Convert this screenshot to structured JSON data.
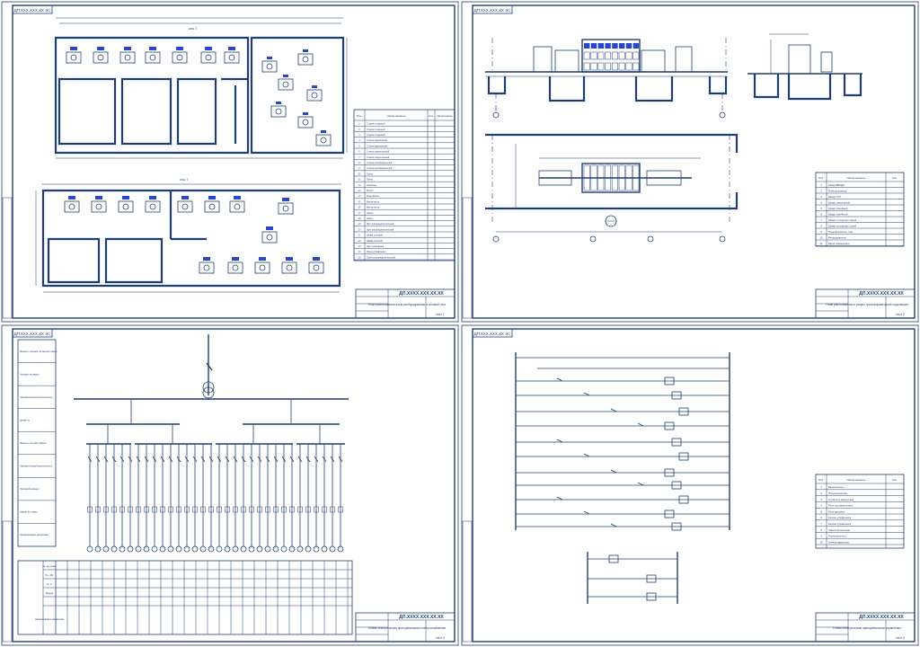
{
  "sheets": {
    "s1": {
      "stamp": "ДП.ХХХ.ХХХ.ХХ ЭС",
      "tb_title": "ДП.ХХХХ.ХХХ.ХХ.ХХ",
      "tb_desc": "План расположения электрооборудования и силовой сети",
      "tb_sheet": "Лист 1"
    },
    "s2": {
      "stamp": "ДП.ХХХ.ХХХ.ХХ ЭС",
      "tb_title": "ДП.ХХХХ.ХХХ.ХХ.ХХ",
      "tb_desc": "План расположения и разрез трансформаторной подстанции",
      "tb_sheet": "Лист 2"
    },
    "s3": {
      "stamp": "ДП.ХХХ.ХХХ.ХХ ЭС",
      "tb_title": "ДП.ХХХХ.ХХХ.ХХ.ХХ",
      "tb_desc": "Схема электрическая принципиальная электроснабжения",
      "tb_sheet": "Лист 3"
    },
    "s4": {
      "stamp": "ДП.ХХХ.ХХХ.ХХ ЭС",
      "tb_title": "ДП.ХХХХ.ХХХ.ХХ.ХХ",
      "tb_desc": "Схема электрическая принципиальная управления",
      "tb_sheet": "Лист 4"
    }
  },
  "s1_legend": {
    "head_pos": "Поз.",
    "head_name": "Наименование",
    "head_qty": "Кол.",
    "head_note": "Примечание",
    "rows": [
      "Станок токарный",
      "Станок токарный",
      "Станок токарный",
      "Станок фрезерный",
      "Станок фрезерный",
      "Станок сверлильный",
      "Станок сверлильный",
      "Станок шлифовальный",
      "Станок шлифовальный",
      "Пресс",
      "Пресс",
      "Ножницы",
      "Молот",
      "Кран-балка",
      "Вентилятор",
      "Вентилятор",
      "Насос",
      "Насос",
      "Щит распределительный",
      "Щит распределительный",
      "Шкаф силовой",
      "Шкаф силовой",
      "Щит освещения",
      "Ящик управления",
      "Пункт распределительный"
    ]
  },
  "s2_spec": {
    "head_pos": "Поз.",
    "head_name": "Наименование",
    "head_qty": "Кол.",
    "rows": [
      "Шкаф ВВОДА",
      "Трансформатор",
      "Шкаф ОТХ",
      "Шкаф секционный",
      "Шкаф линейный",
      "Шкаф линейный",
      "Шкаф отходящих линий",
      "Шкаф отходящих линий",
      "Трансформатор тока",
      "Разъединитель",
      "Шина заземления"
    ]
  },
  "s3_rowlabels": [
    "Марка и сечение питающей линии",
    "Аппарат на вводе",
    "Автоматический выключатель",
    "Длина, м",
    "Марка и сечение кабеля",
    "Автоматический выключатель",
    "Пусковой аппарат",
    "Номер на плане",
    "Наименование механизма"
  ],
  "s3_table": {
    "r1": "№ на плане",
    "r2": "Рн, кВт",
    "r3": "Iн, А",
    "r4": "Марка",
    "r5": "Наименование механизма"
  },
  "s4_spec": {
    "head_pos": "Поз.",
    "head_name": "Наименование",
    "head_qty": "Кол.",
    "rows": [
      "Выключатель",
      "Предохранитель",
      "Пускатель магнитный",
      "Реле промежуточное",
      "Реле времени",
      "Кнопка управления",
      "Кнопка управления",
      "Лампа сигнальная",
      "Переключатель",
      "Электродвигатель"
    ]
  },
  "s1_labels": {
    "axis_top": "ось 7",
    "axis_bot": "ось 7"
  }
}
